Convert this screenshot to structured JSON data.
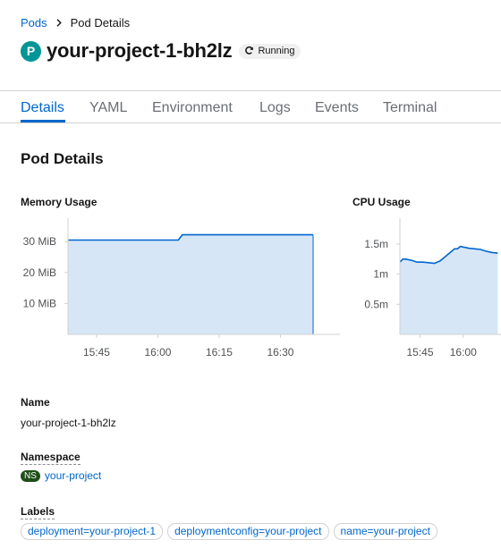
{
  "breadcrumb": {
    "parent": "Pods",
    "current": "Pod Details"
  },
  "header": {
    "badge": "P",
    "title": "your-project-1-bh2lz",
    "status": "Running"
  },
  "tabs": [
    {
      "label": "Details",
      "active": true
    },
    {
      "label": "YAML",
      "active": false
    },
    {
      "label": "Environment",
      "active": false
    },
    {
      "label": "Logs",
      "active": false
    },
    {
      "label": "Events",
      "active": false
    },
    {
      "label": "Terminal",
      "active": false
    }
  ],
  "section_title": "Pod Details",
  "chart_data": [
    {
      "type": "area",
      "title": "Memory Usage",
      "x": [
        "15:38",
        "15:45",
        "16:00",
        "16:05",
        "16:06",
        "16:15",
        "16:30",
        "16:38"
      ],
      "values": [
        30.5,
        30.5,
        30.5,
        30.5,
        32.2,
        32.2,
        32.2,
        32.2
      ],
      "xticks": [
        "15:45",
        "16:00",
        "16:15",
        "16:30"
      ],
      "yticks": [
        {
          "value": 10,
          "label": "10 MiB"
        },
        {
          "value": 20,
          "label": "20 MiB"
        },
        {
          "value": 30,
          "label": "30 MiB"
        }
      ],
      "ylim": [
        0,
        37
      ],
      "xlim": [
        "15:38",
        "16:38"
      ],
      "color": "#0066cc",
      "fill": "#d6e6f7"
    },
    {
      "type": "area",
      "title": "CPU Usage",
      "x": [
        "15:38",
        "15:39",
        "15:40",
        "15:42",
        "15:44",
        "15:46",
        "15:48",
        "15:50",
        "15:52",
        "15:54",
        "15:56",
        "15:57",
        "15:58",
        "15:59",
        "16:00",
        "16:02",
        "16:04",
        "16:06",
        "16:08",
        "16:10",
        "16:12"
      ],
      "values": [
        1.2,
        1.25,
        1.25,
        1.23,
        1.2,
        1.2,
        1.19,
        1.18,
        1.22,
        1.3,
        1.38,
        1.42,
        1.42,
        1.46,
        1.45,
        1.43,
        1.42,
        1.41,
        1.38,
        1.36,
        1.35
      ],
      "xticks": [
        "15:45",
        "16:00"
      ],
      "yticks": [
        {
          "value": 0.5,
          "label": "0.5m"
        },
        {
          "value": 1.0,
          "label": "1m"
        },
        {
          "value": 1.5,
          "label": "1.5m"
        }
      ],
      "ylim": [
        0,
        1.9
      ],
      "xlim": [
        "15:38",
        "16:38"
      ],
      "color": "#0066cc",
      "fill": "#d6e6f7"
    }
  ],
  "details": {
    "name_label": "Name",
    "name_value": "your-project-1-bh2lz",
    "namespace_label": "Namespace",
    "namespace_badge": "NS",
    "namespace_value": "your-project",
    "labels_label": "Labels",
    "labels": [
      "deployment=your-project-1",
      "deploymentconfig=your-project",
      "name=your-project"
    ]
  }
}
